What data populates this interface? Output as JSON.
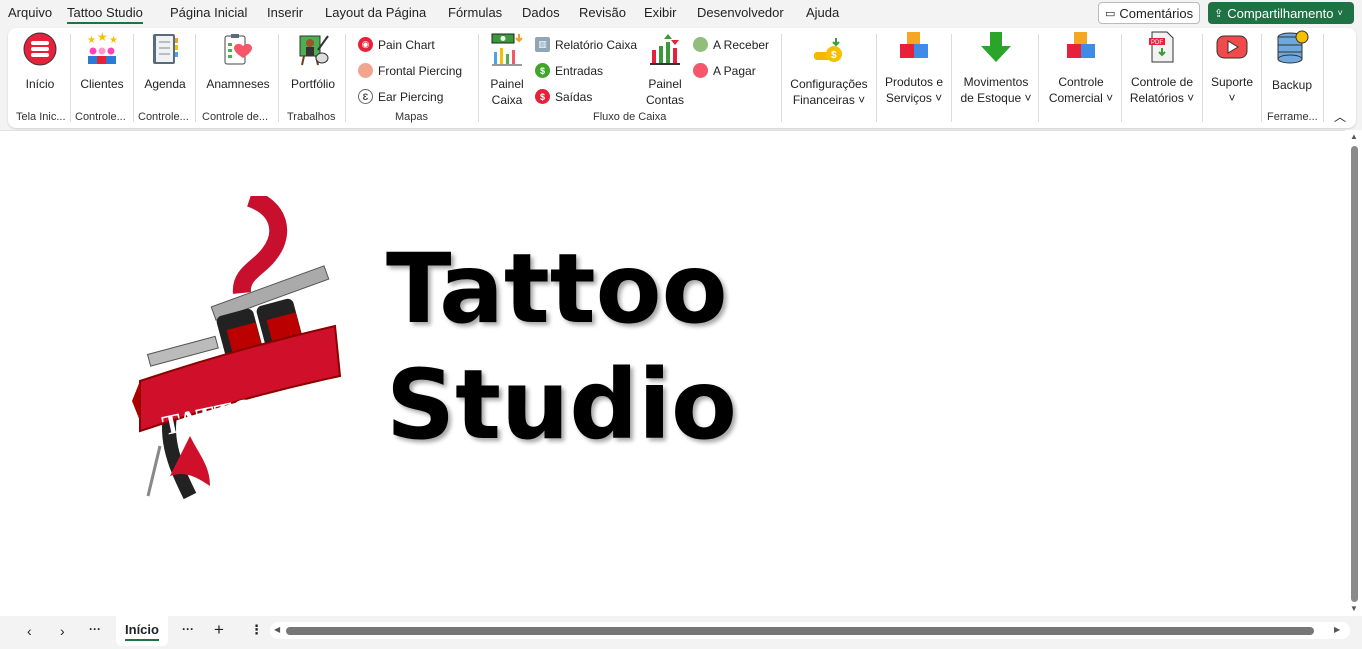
{
  "menu": [
    "Arquivo",
    "Tattoo Studio",
    "Página Inicial",
    "Inserir",
    "Layout da Página",
    "Fórmulas",
    "Dados",
    "Revisão",
    "Exibir",
    "Desenvolvedor",
    "Ajuda"
  ],
  "top_buttons": {
    "comments": "Comentários",
    "share": "Compartilhamento",
    "share_color": "#1f7244"
  },
  "ribbon": {
    "inicio": "Início",
    "clientes": "Clientes",
    "agenda": "Agenda",
    "anamneses": "Anamneses",
    "portfolio": "Portfólio",
    "pain_chart": "Pain Chart",
    "frontal_piercing": "Frontal Piercing",
    "ear_piercing": "Ear Piercing",
    "painel_caixa": [
      "Painel",
      "Caixa"
    ],
    "relatorio_caixa": "Relatório Caixa",
    "entradas": "Entradas",
    "saidas": "Saídas",
    "painel_contas": [
      "Painel",
      "Contas"
    ],
    "a_receber": "A Receber",
    "a_pagar": "A Pagar",
    "config_fin": [
      "Configurações",
      "Financeiras ˅"
    ],
    "produtos": [
      "Produtos e",
      "Serviços ˅"
    ],
    "movimentos": [
      "Movimentos",
      "de Estoque ˅"
    ],
    "controle_comercial": [
      "Controle",
      "Comercial ˅"
    ],
    "controle_relatorios": [
      "Controle de",
      "Relatórios ˅"
    ],
    "suporte": [
      "Suporte",
      "˅"
    ],
    "backup": "Backup",
    "groups": [
      "Tela Inic...",
      "Controle...",
      "Controle...",
      "Controle de...",
      "Trabalhos",
      "Mapas",
      "Fluxo de Caixa",
      "Ferrame..."
    ]
  },
  "logo": {
    "ribbon_text": "TATTOO",
    "title_line1": "Tattoo",
    "title_line2": "Studio"
  },
  "sheet_tabs": {
    "active": "Início"
  }
}
